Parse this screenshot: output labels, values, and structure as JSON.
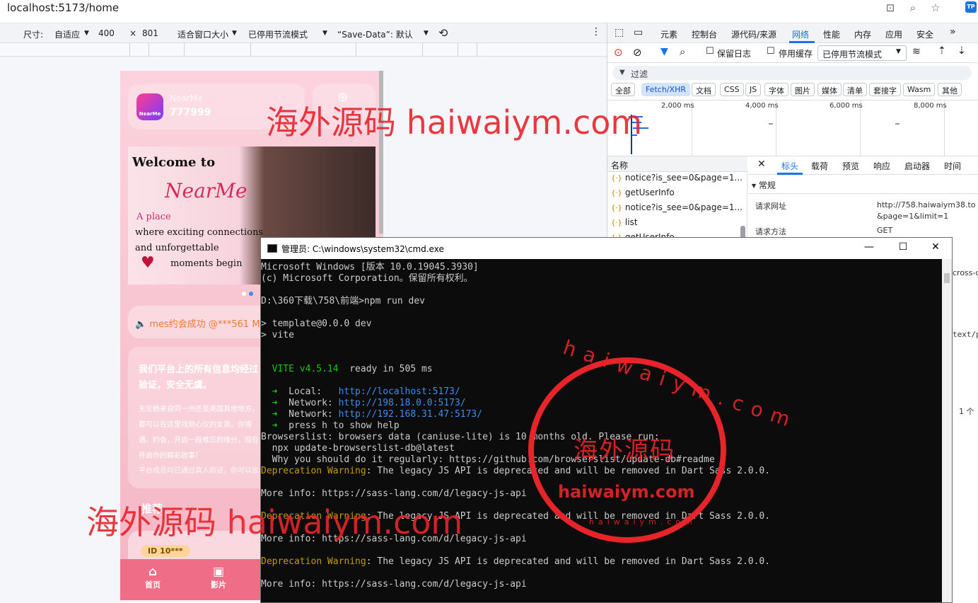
{
  "browser": {
    "url": "localhost:5173/home"
  },
  "device_toolbar": {
    "size_label": "尺寸:",
    "size_mode": "自适应",
    "width": "400",
    "times": "×",
    "height": "801",
    "fit": "适合窗口大小",
    "throttle": "已停用节流模式",
    "save_data": "“Save-Data”: 默认"
  },
  "phone": {
    "app_name": "NearMe",
    "app_icon_text": "NearMe",
    "user_id": "777999",
    "banner": {
      "title": "Welcome to",
      "brand": "NearMe",
      "line1": "A place",
      "line2": "where exciting connections",
      "line3": "and unforgettable",
      "line4": "moments begin"
    },
    "notice": "🔈 mes约会成功 @***561 Mic",
    "info": {
      "heading": "我们平台上的所有信息均经过验证，安全无虞。",
      "body": "无论她来自同一州还是美国其他地方，都可以在这里找到心仪的女孩。你将遇、约会，开启一段难忘的缘分。现在开启你的精彩故事！",
      "verified": "平台成员均已通过真人验证，你可以放心"
    },
    "section_title": "推荐",
    "card_badge": "ID 10***",
    "tabs": [
      {
        "label": "首页",
        "icon": "home-icon"
      },
      {
        "label": "影片",
        "icon": "video-icon"
      }
    ]
  },
  "devtools": {
    "tabs": [
      "元素",
      "控制台",
      "源代码/来源",
      "网络",
      "性能",
      "内存",
      "应用",
      "安全"
    ],
    "active_tab": "网络",
    "toolbar": {
      "preserve_log": "保留日志",
      "disable_cache": "停用缓存",
      "throttle": "已停用节流模式"
    },
    "filter_placeholder": "过滤",
    "types": [
      "全部",
      "Fetch/XHR",
      "文档",
      "CSS",
      "JS",
      "字体",
      "图片",
      "媒体",
      "清单",
      "套接字",
      "Wasm",
      "其他"
    ],
    "active_type": "Fetch/XHR",
    "timeline_ticks": [
      "2,000 ms",
      "4,000 ms",
      "6,000 ms",
      "8,000 ms"
    ],
    "list_header": "名称",
    "requests": [
      "notice?is_see=0&page=1...",
      "getUserInfo",
      "notice?is_see=0&page=1...",
      "list",
      "getUserInfo"
    ],
    "detail_tabs": [
      "标头",
      "载荷",
      "预览",
      "响应",
      "启动器",
      "时间"
    ],
    "active_detail_tab": "标头",
    "section_general": "常规",
    "request_url_label": "请求网址",
    "request_url_value": "http://758.haiwaiym38.to",
    "request_url_value2": "&page=1&limit=1",
    "request_method_label": "请求方法",
    "request_method_value": "GET",
    "partial_cross": "cross-c",
    "partial_text": "text/p",
    "partial_count": "1 个"
  },
  "cmd": {
    "title": "管理员: C:\\windows\\system32\\cmd.exe",
    "lines": [
      "Microsoft Windows [版本 10.0.19045.3930]",
      "(c) Microsoft Corporation。保留所有权利。",
      "",
      "D:\\360下载\\758\\前端>npm run dev",
      "",
      "> template@0.0.0 dev",
      "> vite",
      "",
      "",
      "  VITE v4.5.14  ready in 505 ms",
      "",
      "  ➜  Local:   http://localhost:5173/",
      "  ➜  Network: http://198.18.0.0:5173/",
      "  ➜  Network: http://192.168.31.47:5173/",
      "  ➜  press h to show help",
      "Browserslist: browsers data (caniuse-lite) is 10 months old. Please run:",
      "  npx update-browserslist-db@latest",
      "  Why you should do it regularly: https://github.com/browserslist/update-db#readme",
      "Deprecation Warning: The legacy JS API is deprecated and will be removed in Dart Sass 2.0.0.",
      "",
      "More info: https://sass-lang.com/d/legacy-js-api",
      "",
      "Deprecation Warning: The legacy JS API is deprecated and will be removed in Dart Sass 2.0.0.",
      "",
      "More info: https://sass-lang.com/d/legacy-js-api",
      "",
      "Deprecation Warning: The legacy JS API is deprecated and will be removed in Dart Sass 2.0.0.",
      "",
      "More info: https://sass-lang.com/d/legacy-js-api"
    ]
  },
  "watermarks": {
    "top": "海外源码 haiwaiym.com",
    "bottom": "海外源码 haiwaiym.com",
    "seal_top": "haiwaiym.com",
    "seal_center": "海外源码",
    "seal_domain": "haiwaiym.com",
    "seal_bottom": "haiwaiym.com"
  },
  "colors": {
    "link_blue": "#3b8eea",
    "vite_green": "#16c60c",
    "warning_yellow": "#c19c00",
    "watermark_red": "#e8242b",
    "devtools_accent": "#1a73e8"
  }
}
